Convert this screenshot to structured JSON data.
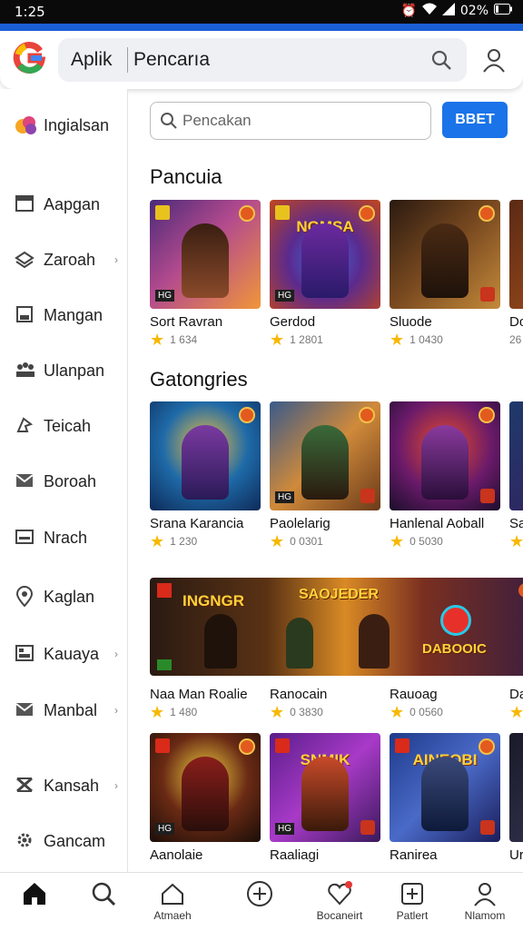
{
  "status_bar": {
    "time": "1:25",
    "battery": "02%"
  },
  "app_bar": {
    "left_label": "Aplik",
    "search_text": "Pencarıa"
  },
  "sidebar": {
    "items": [
      {
        "label": "Ingialsan",
        "icon": "colorful-blob-icon",
        "chevron": false
      },
      {
        "label": "Aapgan",
        "icon": "window-icon",
        "chevron": false
      },
      {
        "label": "Zaroah",
        "icon": "stack-icon",
        "chevron": true
      },
      {
        "label": "Mangan",
        "icon": "floppy-icon",
        "chevron": false
      },
      {
        "label": "Ulanpan",
        "icon": "people-icon",
        "chevron": false
      },
      {
        "label": "Teicah",
        "icon": "hand-icon",
        "chevron": false
      },
      {
        "label": "Boroah",
        "icon": "mail-icon",
        "chevron": false
      },
      {
        "label": "Nrach",
        "icon": "tray-icon",
        "chevron": false
      },
      {
        "label": "Kaglan",
        "icon": "location-pin-icon",
        "chevron": false
      },
      {
        "label": "Kauaya",
        "icon": "image-icon",
        "chevron": true
      },
      {
        "label": "Manbal",
        "icon": "envelope-icon",
        "chevron": true
      },
      {
        "label": "Kansah",
        "icon": "hourglass-icon",
        "chevron": true
      },
      {
        "label": "Gancam",
        "icon": "gear-icon",
        "chevron": false
      }
    ]
  },
  "content": {
    "search": {
      "placeholder": "Pencakan",
      "button": "BBET"
    },
    "section1": {
      "title": "Pancuia",
      "cards": [
        {
          "name": "Sort Ravran",
          "rating": "1 634",
          "title_text": ""
        },
        {
          "name": "Gerdod",
          "rating": "1 2801",
          "title_text": "NGMSA"
        },
        {
          "name": "Sluode",
          "rating": "1 0430",
          "title_text": ""
        },
        {
          "name": "Do",
          "rating": "26",
          "title_text": ""
        }
      ]
    },
    "section2": {
      "title": "Gatongries",
      "cards": [
        {
          "name": "Srana Karancia",
          "rating": "1 230",
          "title_text": ""
        },
        {
          "name": "Paolelarig",
          "rating": "0 0301",
          "title_text": ""
        },
        {
          "name": "Hanlenal Aoball",
          "rating": "0 5030",
          "title_text": ""
        },
        {
          "name": "Sa",
          "rating": "",
          "title_text": ""
        }
      ]
    },
    "banner": {
      "texts": [
        "INGNGR",
        "SAOJEDER",
        "DABOOIC"
      ],
      "items": [
        {
          "name": "Naa Man Roalie",
          "rating": "1 480"
        },
        {
          "name": "Ranocain",
          "rating": "0 3830"
        },
        {
          "name": "Rauoag",
          "rating": "0 0560"
        },
        {
          "name": "Da",
          "rating": ""
        }
      ]
    },
    "section3": {
      "cards": [
        {
          "name": "Aanolaie",
          "title_text": ""
        },
        {
          "name": "Raaliagi",
          "title_text": "SNMIK"
        },
        {
          "name": "Ranirea",
          "title_text": "AINEOBI"
        },
        {
          "name": "Ur",
          "title_text": ""
        }
      ]
    }
  },
  "bottom_nav": [
    {
      "label": "",
      "icon": "home-icon"
    },
    {
      "label": "",
      "icon": "search-icon"
    },
    {
      "label": "Atmaeh",
      "icon": "house-outline-icon"
    },
    {
      "label": "",
      "icon": "plus-circle-icon"
    },
    {
      "label": "Bocaneirt",
      "icon": "heart-icon"
    },
    {
      "label": "Patlert",
      "icon": "plus-square-icon"
    },
    {
      "label": "Nlamom",
      "icon": "person-icon"
    }
  ],
  "colors": {
    "accent": "#1a73e8",
    "header_strip": "#1a5fd6",
    "star": "#f6b800"
  }
}
